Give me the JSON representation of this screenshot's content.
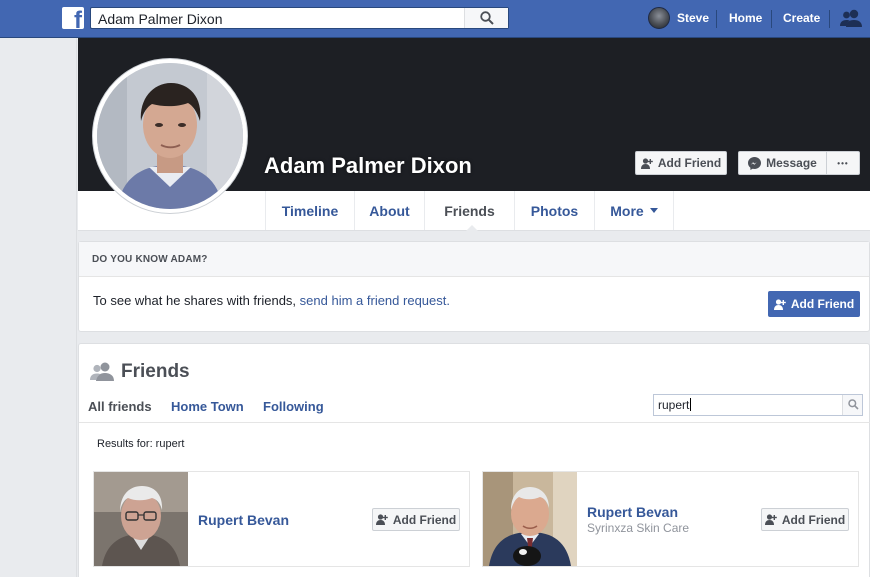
{
  "topbar": {
    "search_value": "Adam Palmer Dixon",
    "user_name": "Steve",
    "home_label": "Home",
    "create_label": "Create"
  },
  "profile": {
    "name": "Adam Palmer Dixon",
    "add_friend_label": "Add Friend",
    "message_label": "Message",
    "more_dots": "•••"
  },
  "tabs": [
    {
      "label": "Timeline"
    },
    {
      "label": "About"
    },
    {
      "label": "Friends"
    },
    {
      "label": "Photos"
    },
    {
      "label": "More"
    }
  ],
  "know": {
    "heading": "DO YOU KNOW ADAM?",
    "text_prefix": "To see what he shares with friends, ",
    "link_text": "send him a friend request.",
    "add_friend_label": "Add Friend"
  },
  "friends": {
    "title": "Friends",
    "tabs": [
      "All friends",
      "Home Town",
      "Following"
    ],
    "search_value": "rupert",
    "results_for": "Results for: rupert",
    "results": [
      {
        "name": "Rupert Bevan",
        "subtitle": "",
        "button_label": "Add Friend"
      },
      {
        "name": "Rupert Bevan",
        "subtitle": "Syrinxza Skin Care",
        "button_label": "Add Friend"
      }
    ]
  },
  "colors": {
    "brand_blue": "#4267b2",
    "link_blue": "#365899",
    "cover_dark": "#1d1f24"
  }
}
